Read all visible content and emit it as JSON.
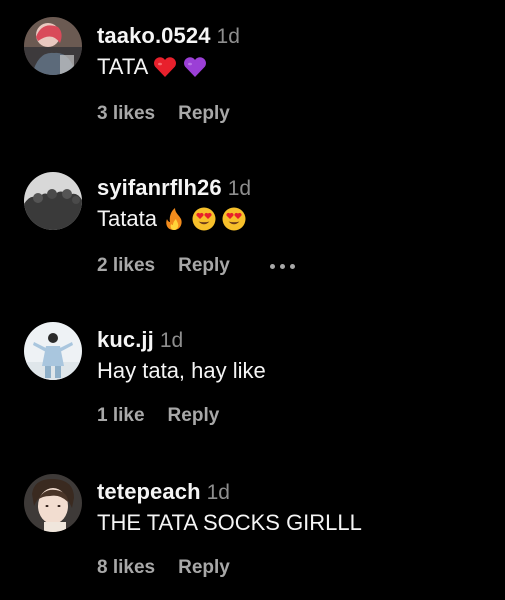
{
  "comments": [
    {
      "username": "taako.0524",
      "time": "1d",
      "text": "TATA",
      "emojis": [
        "red-heart-emoji",
        "purple-heart-emoji"
      ],
      "likes": "3 likes",
      "reply": "Reply"
    },
    {
      "username": "syifanrflh26",
      "time": "1d",
      "text": "Tatata",
      "emojis": [
        "fire-emoji",
        "heart-eyes-emoji",
        "heart-eyes-emoji"
      ],
      "likes": "2 likes",
      "reply": "Reply",
      "has_more_menu": true
    },
    {
      "username": "kuc.jj",
      "time": "1d",
      "text": "Hay tata, hay like",
      "likes": "1 like",
      "reply": "Reply"
    },
    {
      "username": "tetepeach",
      "time": "1d",
      "text": "THE TATA SOCKS GIRLLL",
      "likes": "8 likes",
      "reply": "Reply"
    }
  ],
  "colors": {
    "background": "#000000",
    "username": "#f5f5f5",
    "secondary": "#8e8e8e",
    "action": "#a8a8a8"
  }
}
